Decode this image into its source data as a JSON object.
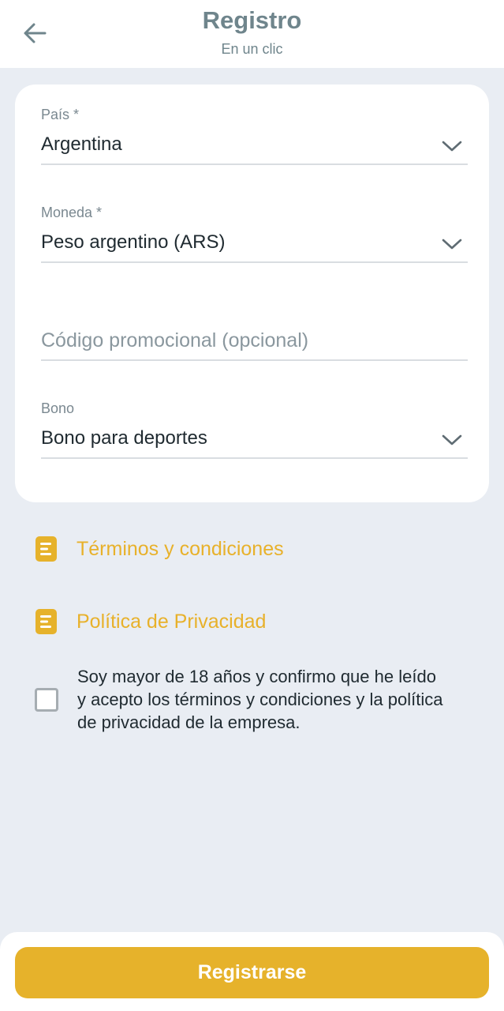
{
  "header": {
    "title": "Registro",
    "subtitle": "En un clic",
    "back_icon": "arrow-left-icon"
  },
  "form": {
    "country": {
      "label": "País *",
      "value": "Argentina"
    },
    "currency": {
      "label": "Moneda *",
      "value": "Peso argentino (ARS)"
    },
    "promo_code": {
      "placeholder": "Código promocional (opcional)",
      "value": ""
    },
    "bonus": {
      "label": "Bono",
      "value": "Bono para deportes"
    }
  },
  "links": {
    "terms": "Términos y condiciones",
    "privacy": "Política de Privacidad",
    "icon": "document-icon"
  },
  "consent": {
    "checked": false,
    "text": "Soy mayor de 18 años y confirmo que he leído y acepto los términos y condiciones y la política de privacidad de la empresa."
  },
  "footer": {
    "register_label": "Registrarse"
  },
  "colors": {
    "accent": "#e6b22b",
    "link": "#e8b12a",
    "background": "#e9edf3",
    "title": "#6f858c"
  }
}
